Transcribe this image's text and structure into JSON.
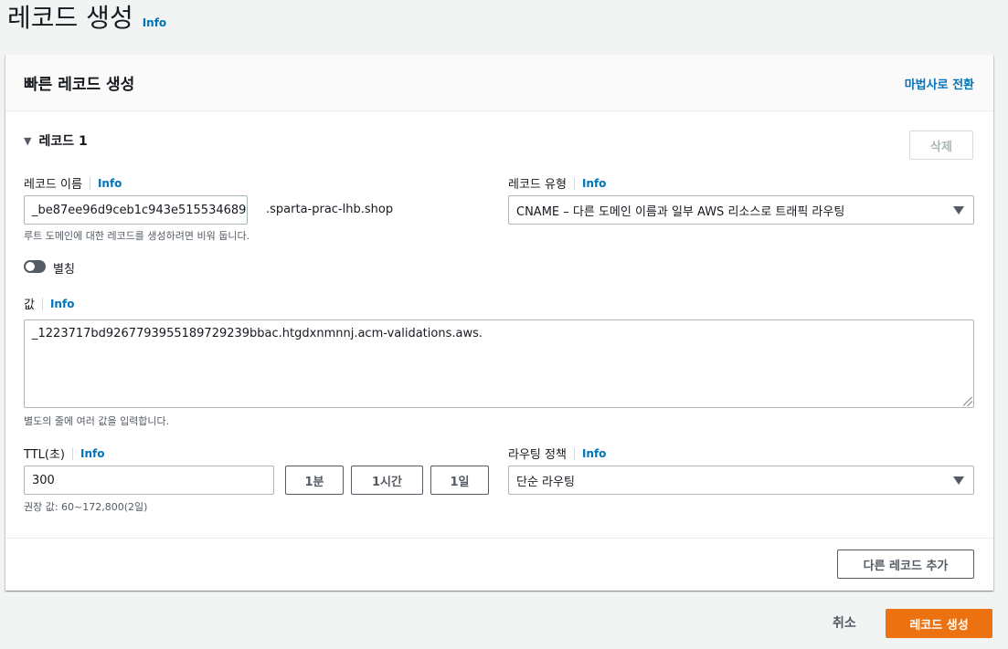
{
  "page": {
    "title": "레코드 생성",
    "info": "Info"
  },
  "panel": {
    "title": "빠른 레코드 생성",
    "wizard_link": "마법사로 전환"
  },
  "record": {
    "section_label": "레코드 1",
    "delete_label": "삭제",
    "name": {
      "label": "레코드 이름",
      "info": "Info",
      "value": "_be87ee96d9ceb1c943e515534689",
      "domain_suffix": ".sparta-prac-lhb.shop",
      "hint": "루트 도메인에 대한 레코드를 생성하려면 비워 둡니다."
    },
    "type": {
      "label": "레코드 유형",
      "info": "Info",
      "selected": "CNAME – 다른 도메인 이름과 일부 AWS 리소스로 트래픽 라우팅"
    },
    "alias": {
      "label": "별칭",
      "enabled": false
    },
    "value": {
      "label": "값",
      "info": "Info",
      "text": "_1223717bd9267793955189729239bbac.htgdxnmnnj.acm-validations.aws.",
      "hint": "별도의 줄에 여러 값을 입력합니다."
    },
    "ttl": {
      "label": "TTL(초)",
      "info": "Info",
      "value": "300",
      "presets": [
        "1분",
        "1시간",
        "1일"
      ],
      "hint": "권장 값: 60~172,800(2일)"
    },
    "routing": {
      "label": "라우팅 정책",
      "info": "Info",
      "selected": "단순 라우팅"
    }
  },
  "footer": {
    "add_record": "다른 레코드 추가",
    "cancel": "취소",
    "create": "레코드 생성"
  },
  "colors": {
    "primary": "#ec7211",
    "link": "#0073bb"
  }
}
